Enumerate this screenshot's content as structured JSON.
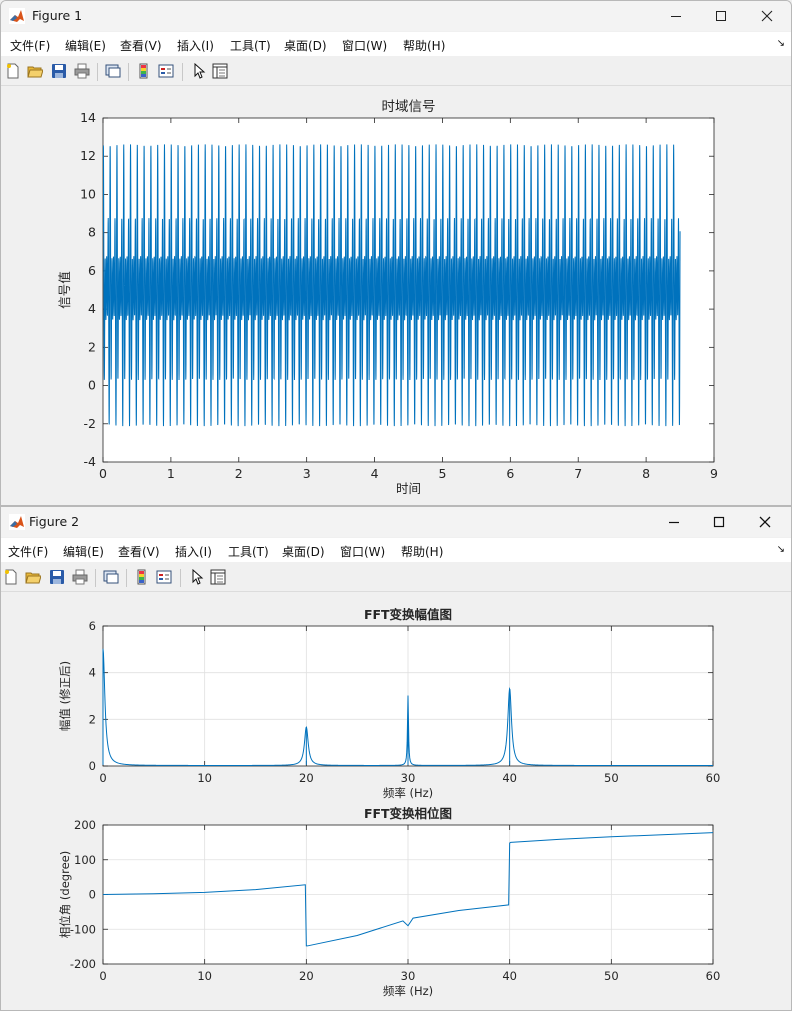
{
  "figure1": {
    "title": "Figure 1",
    "menu": [
      "文件(F)",
      "编辑(E)",
      "查看(V)",
      "插入(I)",
      "工具(T)",
      "桌面(D)",
      "窗口(W)",
      "帮助(H)"
    ],
    "chart": {
      "title": "时域信号",
      "xlabel": "时间",
      "ylabel": "信号值"
    }
  },
  "figure2": {
    "title": "Figure 2",
    "menu": [
      "文件(F)",
      "编辑(E)",
      "查看(V)",
      "插入(I)",
      "工具(T)",
      "桌面(D)",
      "窗口(W)",
      "帮助(H)"
    ],
    "chart_top": {
      "title": "FFT变换幅值图",
      "xlabel": "频率 (Hz)",
      "ylabel": "幅值 (修正后)"
    },
    "chart_bottom": {
      "title": "FFT变换相位图",
      "xlabel": "频率 (Hz)",
      "ylabel": "相位角 (degree)"
    }
  },
  "colors": {
    "line": "#0072BD",
    "axes_bg": "#ffffff",
    "grid": "#e0e0e0",
    "matlab_logo": "#d95319"
  },
  "chart_data": [
    {
      "type": "line",
      "title": "时域信号",
      "xlabel": "时间",
      "ylabel": "信号值",
      "xlim": [
        0,
        9
      ],
      "ylim": [
        -4,
        14
      ],
      "xticks": [
        0,
        1,
        2,
        3,
        4,
        5,
        6,
        7,
        8,
        9
      ],
      "yticks": [
        -4,
        -2,
        0,
        2,
        4,
        6,
        8,
        10,
        12,
        14
      ],
      "grid": false,
      "x_range": [
        0,
        8.5
      ],
      "signal": {
        "offset": 5,
        "components": [
          {
            "freq_hz": 20,
            "amp": 1.6
          },
          {
            "freq_hz": 30,
            "amp": 3.0
          },
          {
            "freq_hz": 40,
            "amp": 3.3
          }
        ],
        "y_min": -3.2,
        "y_max": 13.2
      }
    },
    {
      "type": "line",
      "title": "FFT变换幅值图",
      "xlabel": "频率 (Hz)",
      "ylabel": "幅值 (修正后)",
      "xlim": [
        0,
        60
      ],
      "ylim": [
        0,
        6
      ],
      "xticks": [
        0,
        10,
        20,
        30,
        40,
        50,
        60
      ],
      "yticks": [
        0,
        2,
        4,
        6
      ],
      "grid": true,
      "peaks": [
        {
          "x": 0,
          "y": 5.0
        },
        {
          "x": 20,
          "y": 1.65
        },
        {
          "x": 30,
          "y": 3.0
        },
        {
          "x": 40,
          "y": 3.3
        }
      ]
    },
    {
      "type": "line",
      "title": "FFT变换相位图",
      "xlabel": "频率 (Hz)",
      "ylabel": "相位角 (degree)",
      "xlim": [
        0,
        60
      ],
      "ylim": [
        -200,
        200
      ],
      "xticks": [
        0,
        10,
        20,
        30,
        40,
        50,
        60
      ],
      "yticks": [
        -200,
        -100,
        0,
        100,
        200
      ],
      "grid": true,
      "x": [
        0,
        5,
        10,
        15,
        19.9,
        20,
        20.1,
        25,
        29.5,
        30,
        30.5,
        35,
        39.9,
        40,
        40.1,
        45,
        50,
        55,
        60
      ],
      "y": [
        0,
        2,
        6,
        14,
        28,
        -148,
        -148,
        -118,
        -76,
        -90,
        -68,
        -46,
        -30,
        148,
        150,
        159,
        166,
        172,
        178
      ]
    }
  ]
}
